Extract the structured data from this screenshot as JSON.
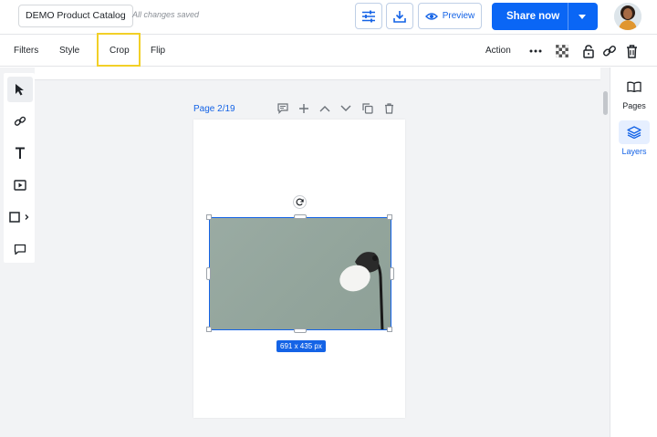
{
  "header": {
    "doc_title": "DEMO Product Catalog",
    "save_status": "All changes saved",
    "preview_label": "Preview",
    "share_label": "Share now"
  },
  "toolbar": {
    "tabs": [
      {
        "label": "Filters"
      },
      {
        "label": "Style"
      },
      {
        "label": "Crop",
        "highlighted": true
      },
      {
        "label": "Flip"
      }
    ],
    "action_label": "Action",
    "icons": [
      "more-icon",
      "transparency-icon",
      "lock-icon",
      "link-icon",
      "trash-icon"
    ]
  },
  "left_tools": [
    "select-tool-icon",
    "link-tool-icon",
    "text-tool-icon",
    "media-tool-icon",
    "shape-tool-icon",
    "comment-tool-icon"
  ],
  "right_panel": {
    "items": [
      {
        "label": "Pages",
        "icon": "book-icon"
      },
      {
        "label": "Layers",
        "icon": "layers-icon",
        "active": true
      }
    ]
  },
  "page_controls": {
    "label": "Page 2/19",
    "icons": [
      "comment-icon",
      "add-page-icon",
      "move-up-icon",
      "move-down-icon",
      "duplicate-icon",
      "delete-page-icon"
    ]
  },
  "selection": {
    "size_label": "691 x 435 px"
  },
  "colors": {
    "accent": "#1463e6",
    "share_button": "#0a66f5",
    "crop_highlight": "#f2d027",
    "canvas_bg": "#f2f3f5"
  }
}
